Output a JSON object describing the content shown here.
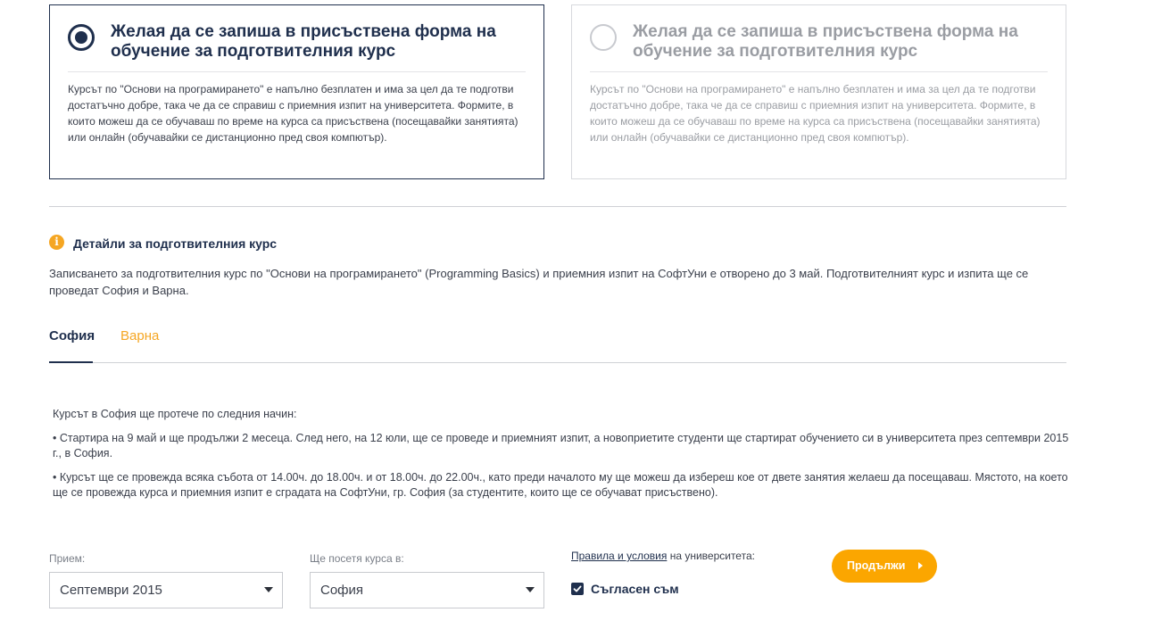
{
  "options": [
    {
      "title": "Желая да се запиша в присъствена форма на обучение за подготвителния курс",
      "text": "Курсът по \"Основи на програмирането\" е напълно безплатен и има за цел да те подготви достатъчно добре, така че да се справиш с приемния изпит на университета. Формите, в които можеш да се обучаваш по време на курса са присъствена (посещавайки занятията) или онлайн (обучавайки се дистанционно пред своя компютър).",
      "selected": true
    },
    {
      "title": "Желая да се запиша в присъствена форма на обучение за подготвителния курс",
      "text": "Курсът по \"Основи на програмирането\" е напълно безплатен и има за цел да те подготви достатъчно добре, така че да се справиш с приемния изпит на университета. Формите, в които можеш да се обучаваш по време на курса са присъствена (посещавайки занятията) или онлайн (обучавайки се дистанционно пред своя компютър).",
      "selected": false
    }
  ],
  "details": {
    "icon": "info-icon",
    "icon_glyph": "i",
    "title": "Детайли за подготвителния курс",
    "text": "Записването за подготвителния курс по \"Основи на програмирането\" (Programming Basics) и приемния изпит на СофтУни е отворено до 3 май. Подготвителният курс и изпита ще се проведат София и Варна."
  },
  "tabs": [
    {
      "label": "София",
      "active": true
    },
    {
      "label": "Варна",
      "active": false
    }
  ],
  "course": {
    "intro": "Курсът в София ще протече по следния начин:",
    "bullet1": "• Стартира на 9 май и ще продължи 2 месеца. След него, на 12 юли, ще се проведе и приемният изпит, а новоприетите студенти ще стартират обучението си в университета през септември 2015 г., в София.",
    "bullet2": "• Курсът ще се провежда всяка събота от 14.00ч. до 18.00ч. и от 18.00ч. до 22.00ч., като преди началото му ще можеш да избереш кое от двете занятия желаеш да посещаваш. Мястото, на което ще се провежда курса и приемния изпит е сградата на СофтУни, гр. София (за студентите, които ще се обучават присъствено)."
  },
  "form": {
    "intake_label": "Прием:",
    "intake_value": "Септември 2015",
    "city_label": "Ще посетя курса в:",
    "city_value": "София",
    "terms_link": "Правила и условия",
    "terms_rest": " на университета:",
    "agree_label": "Съгласен съм",
    "agree_checked": true,
    "continue_label": "Продължи"
  },
  "colors": {
    "primary": "#1f2f4d",
    "accent": "#fba600",
    "muted": "#9a9da3"
  }
}
